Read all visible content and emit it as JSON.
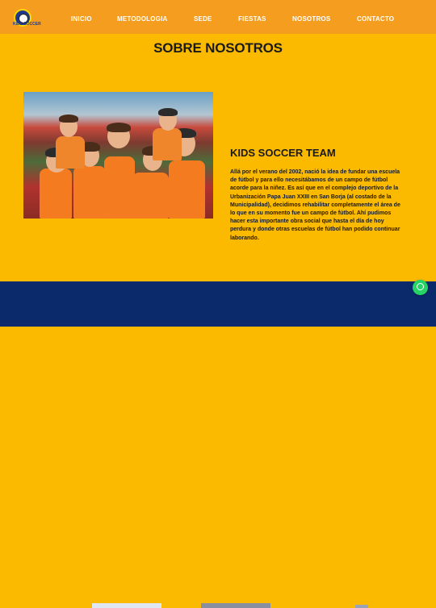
{
  "nav": {
    "logo_text": "KIDS SOCCER",
    "items": [
      "INICIO",
      "METODOLOGIA",
      "SEDE",
      "FIESTAS",
      "NOSOTROS",
      "CONTACTO"
    ]
  },
  "page": {
    "title": "SOBRE NOSOTROS"
  },
  "about": {
    "heading": "KIDS SOCCER TEAM",
    "paragraph": "Allá por el verano del 2002, nació la idea de fundar una escuela de fútbol y para ello necesitábamos de un campo de fútbol acorde para la niñez. Es así que en el complejo deportivo de la Urbanización Papa Juan XXIII en San Borja (al costado de la Municipalidad), decidimos rehabilitar completamente el área de lo que en su momento fue un campo de fútbol. Ahí pudimos hacer esta importante obra social que hasta el día de hoy perdura y donde otras escuelas de fútbol han podido continuar laborando."
  },
  "colors": {
    "nav_bg": "#f59d1e",
    "page_bg": "#fbb900",
    "footer_bg": "#0a2a6b",
    "whatsapp": "#25d366"
  },
  "icons": {
    "logo": "soccer-ball-logo",
    "floating": "whatsapp-icon"
  }
}
